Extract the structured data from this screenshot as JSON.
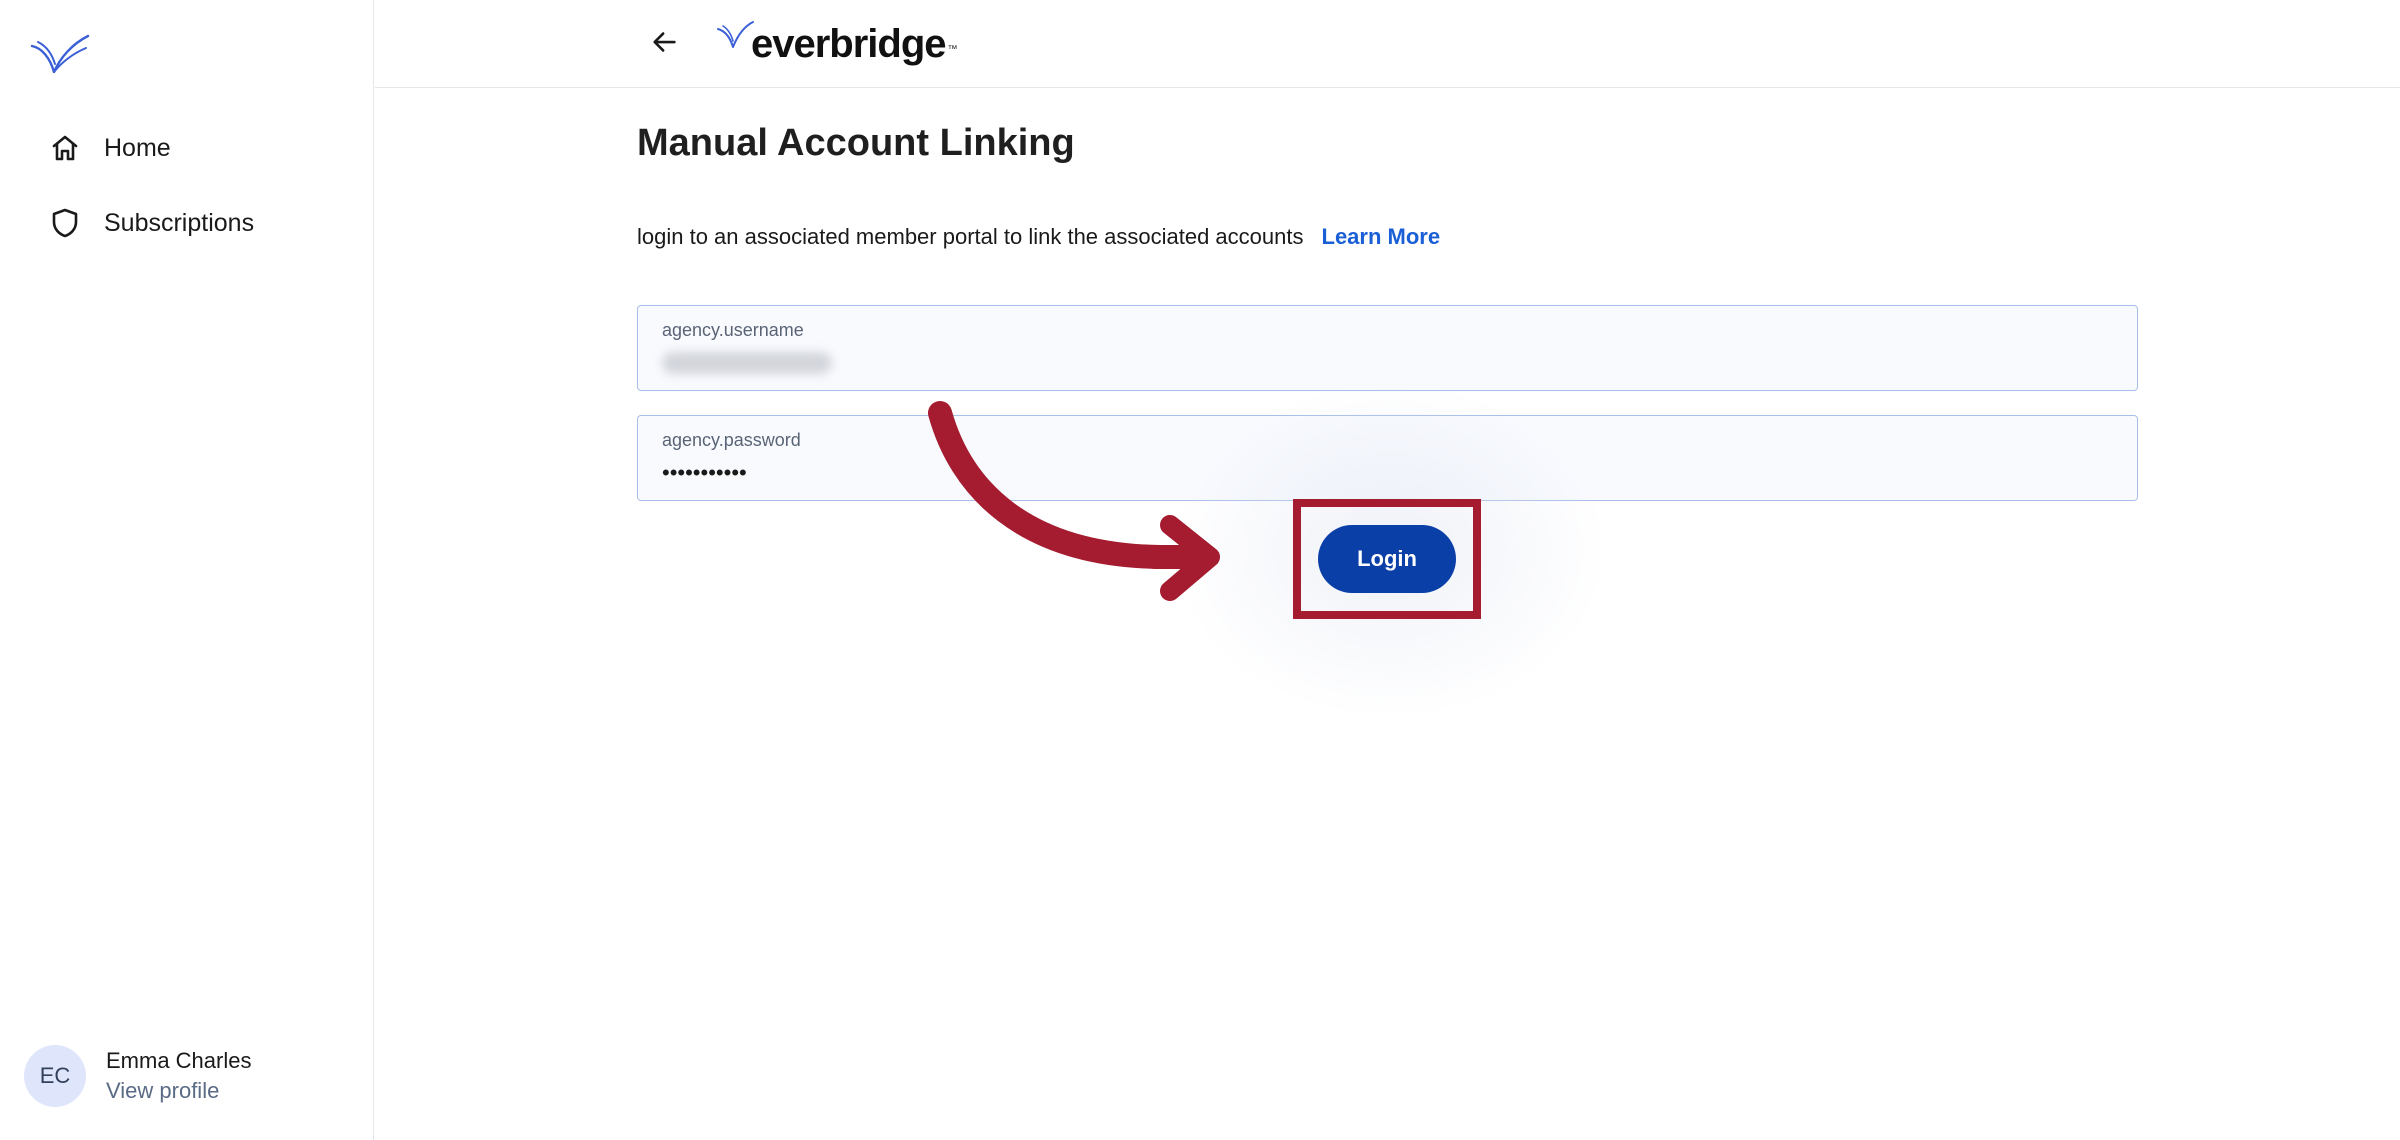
{
  "sidebar": {
    "logo_icon": "everbridge-bird-icon",
    "items": [
      {
        "label": "Home",
        "icon": "home-icon"
      },
      {
        "label": "Subscriptions",
        "icon": "shield-icon"
      }
    ],
    "profile": {
      "initials": "EC",
      "name": "Emma Charles",
      "link": "View profile"
    }
  },
  "header": {
    "back_icon": "arrow-left-icon",
    "brand": "everbridge",
    "brand_tm": "™"
  },
  "main": {
    "title": "Manual Account Linking",
    "description": "login to an associated member portal to link the associated accounts",
    "learn_more": "Learn More",
    "username_field": {
      "label": "agency.username"
    },
    "password_field": {
      "label": "agency.password",
      "value": "•••••••••••"
    },
    "login_button": "Login"
  },
  "annotation": {
    "color": "#a51c30"
  },
  "colors": {
    "accent": "#0b3fa8",
    "link": "#1a5fd6",
    "highlight": "#a51c30"
  }
}
